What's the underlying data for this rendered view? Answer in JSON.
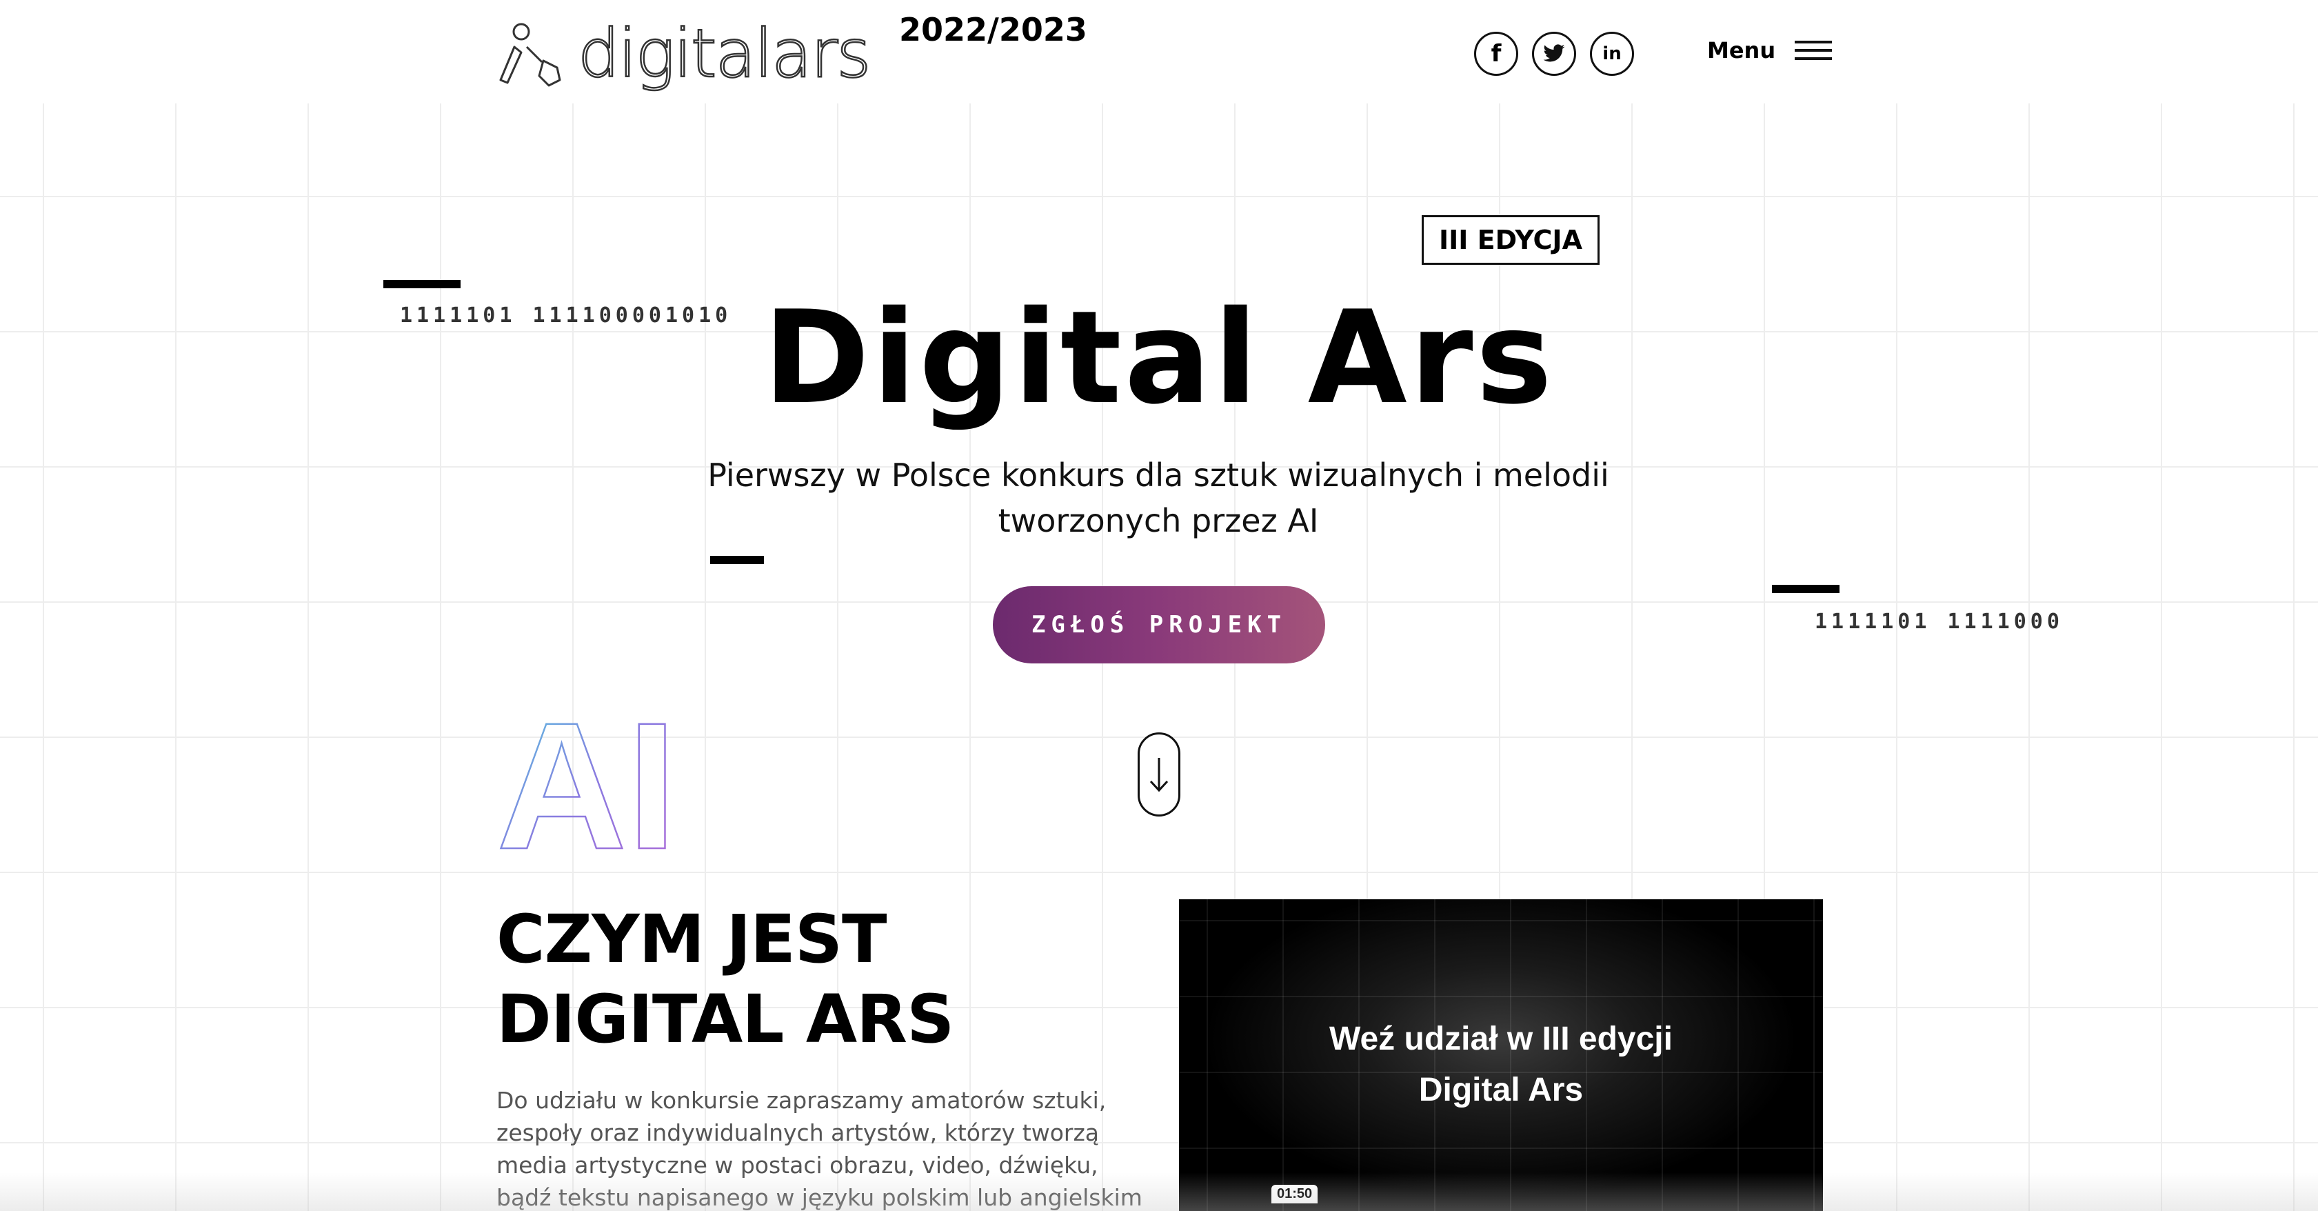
{
  "header": {
    "logo_text": "digitalars",
    "year": "2022/2023",
    "social": [
      {
        "name": "facebook",
        "glyph": "f"
      },
      {
        "name": "twitter",
        "glyph": "🐦"
      },
      {
        "name": "linkedin",
        "glyph": "in"
      }
    ],
    "menu_label": "Menu"
  },
  "hero": {
    "edition_badge": "III EDYCJA",
    "binary_left": "1111101 111100001010",
    "binary_right": "1111101 1111000",
    "title": "Digital Ars",
    "subtitle_line1": "Pierwszy w Polsce konkurs dla sztuk wizualnych i melodii",
    "subtitle_line2": "tworzonych przez AI",
    "cta_label": "ZGŁOŚ PROJEKT",
    "decorative_text": "AI"
  },
  "about": {
    "title_line1": "CZYM JEST",
    "title_line2": "DIGITAL ARS",
    "text": "Do udziału w konkursie zapraszamy amatorów sztuki, zespoły oraz indywidualnych artystów, którzy tworzą media artystyczne w postaci obrazu, video, dźwięku, bądź tekstu napisanego w języku polskim lub angielskim z"
  },
  "video": {
    "title_line1": "Weź udział w III edycji",
    "title_line2": "Digital Ars",
    "duration": "01:50"
  },
  "colors": {
    "cta_gradient_start": "#6c2a6e",
    "cta_gradient_end": "#a4547a",
    "text_primary": "#000000",
    "text_muted": "#555555"
  }
}
